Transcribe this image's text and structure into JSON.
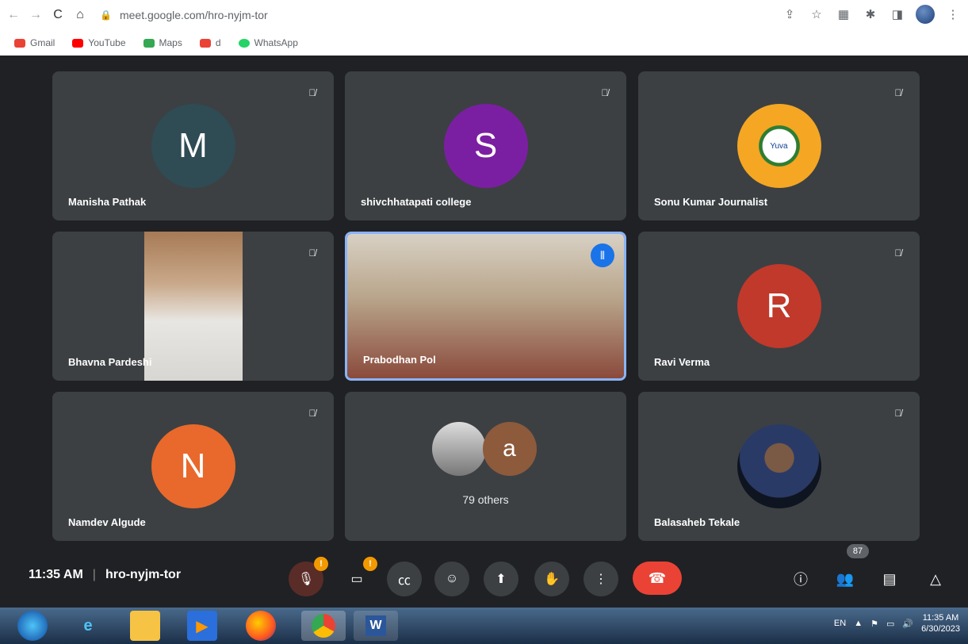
{
  "browser": {
    "url": "meet.google.com/hro-nyjm-tor",
    "bookmarks": [
      {
        "label": "Gmail",
        "color": "#ea4335"
      },
      {
        "label": "YouTube",
        "color": "#ff0000"
      },
      {
        "label": "Maps",
        "color": "#34a853"
      },
      {
        "label": "d",
        "color": "#ea4335"
      },
      {
        "label": "WhatsApp",
        "color": "#25d366"
      }
    ]
  },
  "tiles": [
    {
      "name": "Manisha Pathak",
      "initial": "M",
      "color": "#2f4b54"
    },
    {
      "name": "shivchhatapati college",
      "initial": "S",
      "color": "#7b1fa2"
    },
    {
      "name": "Sonu Kumar Journalist",
      "logo_text": "Yuva"
    },
    {
      "name": "Bhavna Pardeshi"
    },
    {
      "name": "Prabodhan Pol"
    },
    {
      "name": "Ravi Verma",
      "initial": "R",
      "color": "#c0392b"
    },
    {
      "name": "Namdev Algude",
      "initial": "N",
      "color": "#e8692b"
    },
    {
      "others_label": "79 others",
      "initial": "a",
      "color": "#8d5a3c"
    },
    {
      "name": "Balasaheb Tekale"
    }
  ],
  "meeting": {
    "time": "11:35 AM",
    "code": "hro-nyjm-tor",
    "participants_count": "87"
  },
  "taskbar": {
    "lang": "EN",
    "time": "11:35 AM",
    "date": "6/30/2023"
  }
}
